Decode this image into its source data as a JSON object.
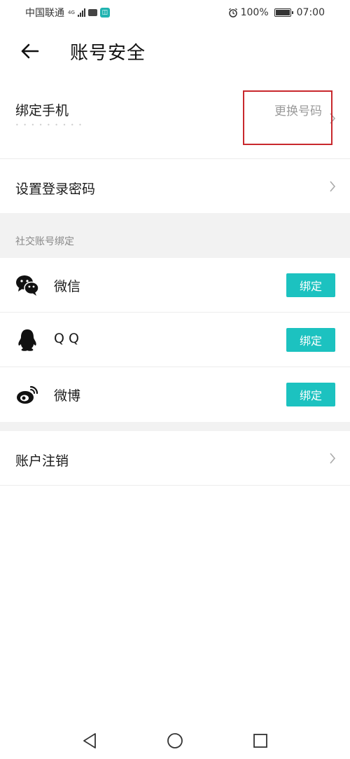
{
  "status_bar": {
    "carrier": "中国联通",
    "network": "4G",
    "battery": "100%",
    "time": "07:00"
  },
  "header": {
    "title": "账号安全"
  },
  "phone_section": {
    "label": "绑定手机",
    "masked_number": "• • • • •   • • • •",
    "change_label": "更换号码"
  },
  "password_row": {
    "label": "设置登录密码"
  },
  "social_section": {
    "title": "社交账号绑定",
    "items": [
      {
        "label": "微信",
        "icon": "wechat-icon",
        "button": "绑定"
      },
      {
        "label": "Q Q",
        "icon": "qq-icon",
        "button": "绑定"
      },
      {
        "label": "微博",
        "icon": "weibo-icon",
        "button": "绑定"
      }
    ]
  },
  "account_row": {
    "label": "账户注销"
  },
  "colors": {
    "accent": "#1cc2c0",
    "highlight": "#c8282d",
    "section_bg": "#f2f2f2"
  }
}
